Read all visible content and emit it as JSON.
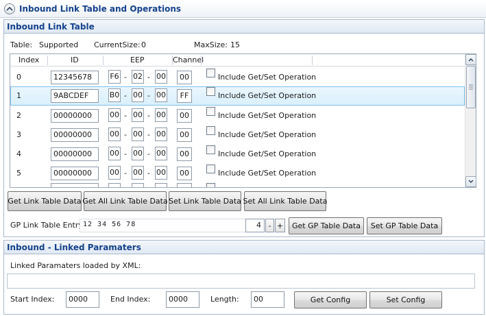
{
  "main_header": {
    "title": "Inbound Link Table and Operations"
  },
  "link_table_group": {
    "title": "Inbound Link Table",
    "table_label": "Table:",
    "table_value": "Supported",
    "current_size_label": "CurrentSize:",
    "current_size_value": "0",
    "max_size_label": "MaxSize:",
    "max_size_value": "15",
    "columns": {
      "index": "Index",
      "id": "ID",
      "eep": "EEP",
      "channel": "Channel"
    },
    "eep_separator": "-",
    "checkbox_label": "Include Get/Set Operation",
    "rows": [
      {
        "index": "0",
        "id": "12345678",
        "eep1": "F6",
        "eep2": "02",
        "eep3": "00",
        "channel": "00",
        "selected": false
      },
      {
        "index": "1",
        "id": "9ABCDEF",
        "eep1": "B0",
        "eep2": "00",
        "eep3": "00",
        "channel": "FF",
        "selected": true
      },
      {
        "index": "2",
        "id": "00000000",
        "eep1": "00",
        "eep2": "00",
        "eep3": "00",
        "channel": "00",
        "selected": false
      },
      {
        "index": "3",
        "id": "00000000",
        "eep1": "00",
        "eep2": "00",
        "eep3": "00",
        "channel": "00",
        "selected": false
      },
      {
        "index": "4",
        "id": "00000000",
        "eep1": "00",
        "eep2": "00",
        "eep3": "00",
        "channel": "00",
        "selected": false
      },
      {
        "index": "5",
        "id": "00000000",
        "eep1": "00",
        "eep2": "00",
        "eep3": "00",
        "channel": "00",
        "selected": false
      }
    ],
    "buttons": {
      "get_link_table": "Get Link Table Data",
      "get_all_link_table": "Get All Link Table Data",
      "set_link_table": "Set Link Table Data",
      "set_all_link_table": "Set All Link Table Data"
    },
    "gp_entry_label": "GP Link Table Entry",
    "gp_entry_value": "12 34 56 78",
    "gp_index_value": "4",
    "stepper_minus": "-",
    "stepper_plus": "+",
    "get_gp_button": "Get GP Table Data",
    "set_gp_button": "Set GP Table Data"
  },
  "linked_params_group": {
    "title": "Inbound - Linked Paramaters",
    "loaded_label": "Linked Paramaters loaded by XML:",
    "loaded_value": "",
    "start_index_label": "Start Index:",
    "start_index_value": "0000",
    "end_index_label": "End Index:",
    "end_index_value": "0000",
    "length_label": "Length:",
    "length_value": "00",
    "get_config_button": "Get Config",
    "set_config_button": "Set Config"
  },
  "icons": {
    "collapse": "chevron-up-icon",
    "scroll_up": "arrow-up-icon",
    "scroll_down": "arrow-down-icon",
    "scroll_grip": "grip-icon"
  },
  "colors": {
    "title_text": "#15428b",
    "selection_border": "#7dc2ea",
    "selection_fill": "#d9f0fc"
  }
}
